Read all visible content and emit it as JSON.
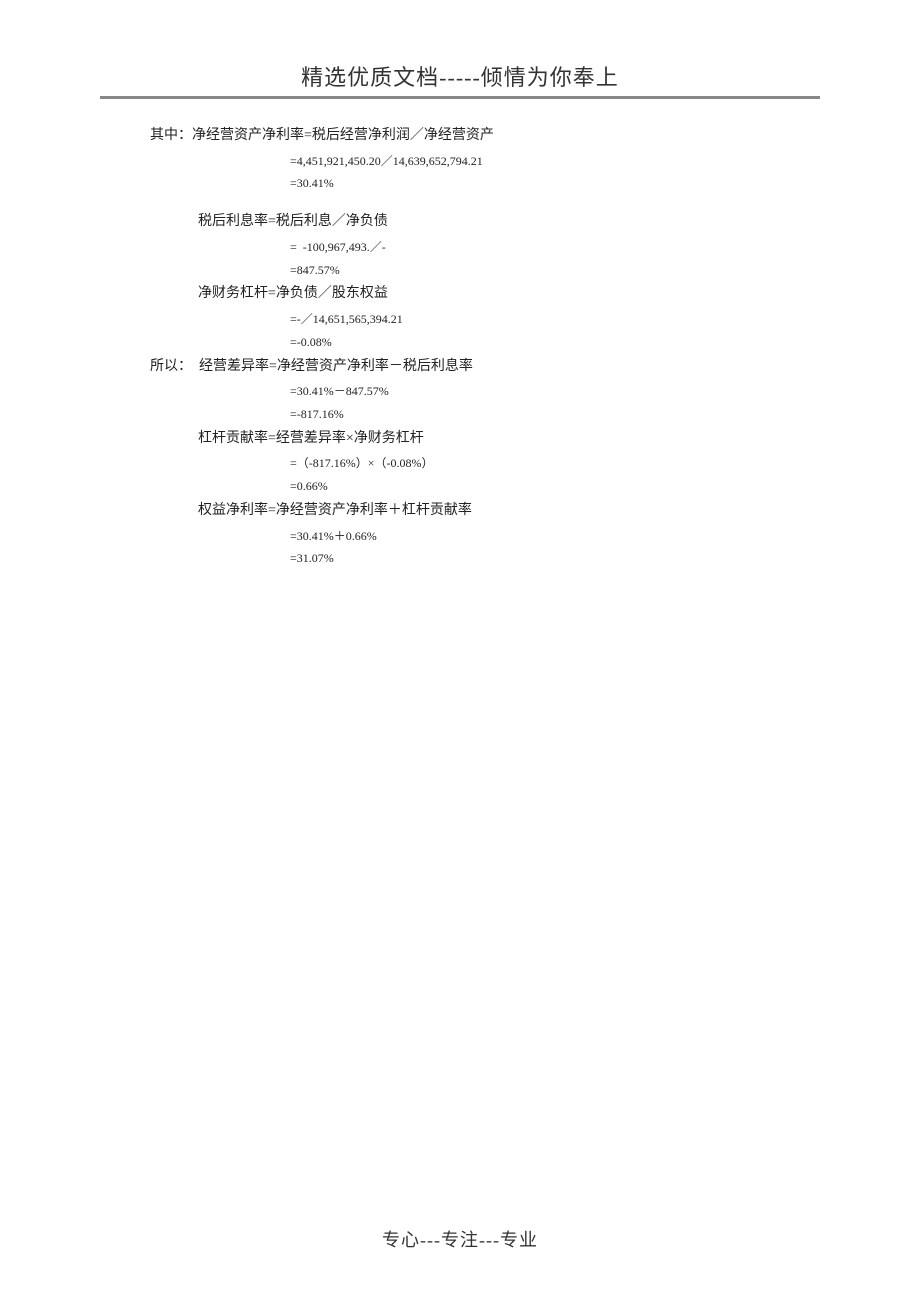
{
  "header": "精选优质文档-----倾情为你奉上",
  "footer": "专心---专注---专业",
  "lines": [
    {
      "cls": "indent-0",
      "text": "其中：净经营资产净利率=税后经营净利润／净经营资产"
    },
    {
      "cls": "indent-calc small",
      "text": "=4,451,921,450.20／14,639,652,794.21"
    },
    {
      "cls": "indent-calc small",
      "text": "=30.41%"
    },
    {
      "cls": "spacer",
      "text": ""
    },
    {
      "cls": "indent-1",
      "text": "税后利息率=税后利息／净负债"
    },
    {
      "cls": "indent-calc small",
      "text": "=  -100,967,493.／-"
    },
    {
      "cls": "indent-calc small",
      "text": "=847.57%"
    },
    {
      "cls": "indent-1",
      "text": "净财务杠杆=净负债／股东权益"
    },
    {
      "cls": "indent-calc small",
      "text": "=-／14,651,565,394.21"
    },
    {
      "cls": "indent-calc small",
      "text": "=-0.08%"
    },
    {
      "cls": "indent-0",
      "text": "所以：  经营差异率=净经营资产净利率－税后利息率"
    },
    {
      "cls": "indent-calc small",
      "text": "=30.41%－847.57%"
    },
    {
      "cls": "indent-calc small",
      "text": "=-817.16%"
    },
    {
      "cls": "indent-1",
      "text": "杠杆贡献率=经营差异率×净财务杠杆"
    },
    {
      "cls": "indent-calc small",
      "text": "=（-817.16%）×（-0.08%）"
    },
    {
      "cls": "indent-calc small",
      "text": "=0.66%"
    },
    {
      "cls": "indent-1",
      "text": "权益净利率=净经营资产净利率＋杠杆贡献率"
    },
    {
      "cls": "indent-calc small",
      "text": "=30.41%＋0.66%"
    },
    {
      "cls": "indent-calc small",
      "text": "=31.07%"
    }
  ]
}
